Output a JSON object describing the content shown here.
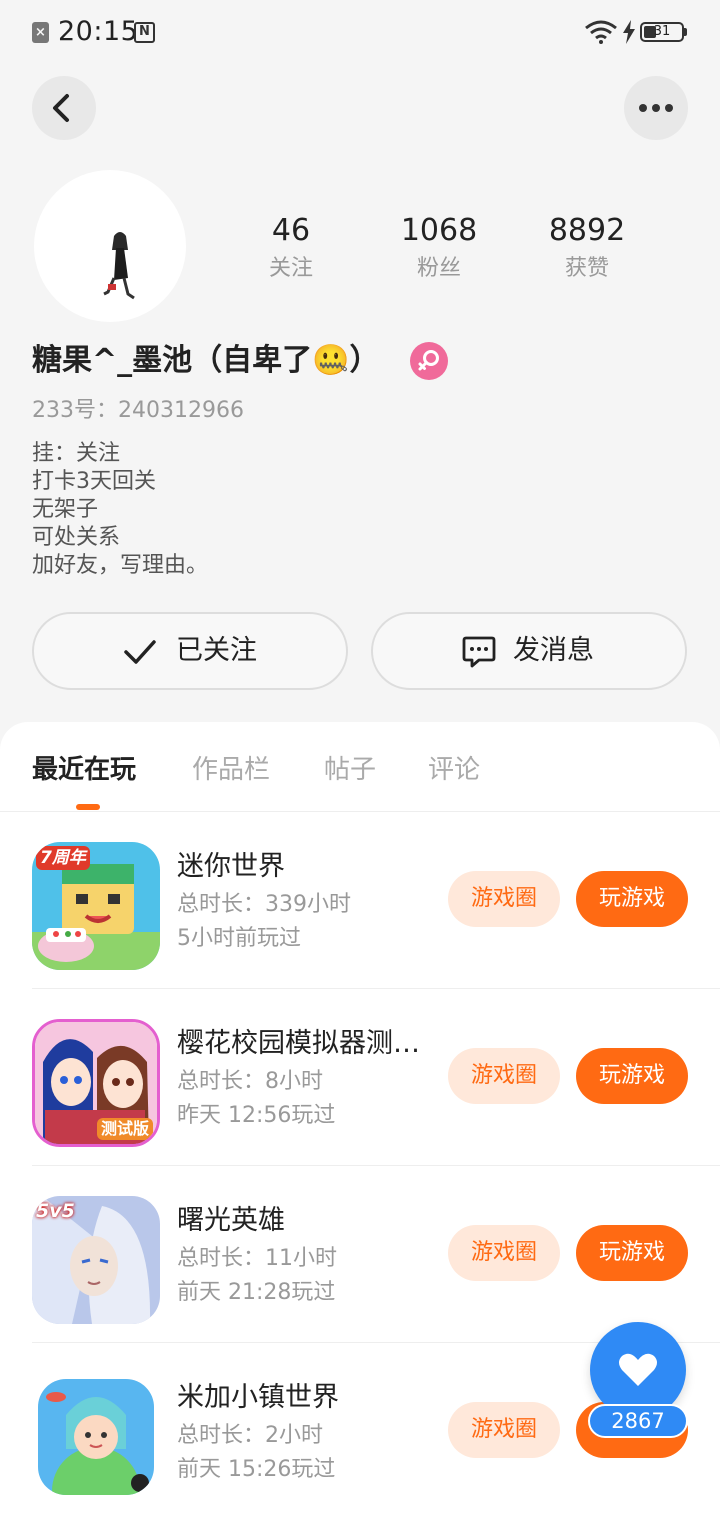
{
  "status_bar": {
    "time": "20:15",
    "battery_level": "31",
    "icons": [
      "notification-icon",
      "nfc-icon",
      "wifi-icon",
      "charging-icon",
      "battery-icon"
    ]
  },
  "nav": {
    "back_icon": "back-arrow-icon",
    "more_icon": "more-dots-icon"
  },
  "profile": {
    "stats": [
      {
        "value": "46",
        "label": "关注"
      },
      {
        "value": "1068",
        "label": "粉丝"
      },
      {
        "value": "8892",
        "label": "获赞"
      }
    ],
    "username": "糖果^_墨池（自卑了🤐）",
    "gender_icon": "female-icon",
    "uid": "233号：240312966",
    "bio": [
      "挂：关注",
      "打卡3天回关",
      "无架子",
      "可处关系",
      "加好友，写理由。"
    ],
    "follow_button": "已关注",
    "message_button": "发消息"
  },
  "tabs": [
    {
      "label": "最近在玩",
      "active": true
    },
    {
      "label": "作品栏",
      "active": false
    },
    {
      "label": "帖子",
      "active": false
    },
    {
      "label": "评论",
      "active": false
    }
  ],
  "games": [
    {
      "name": "迷你世界",
      "duration": "总时长：339小时",
      "last_played": "5小时前玩过",
      "circle_label": "游戏圈",
      "play_label": "玩游戏",
      "icon": "mini-world-game-icon",
      "icon_badge": "7周年"
    },
    {
      "name": "樱花校园模拟器测…",
      "duration": "总时长：8小时",
      "last_played": "昨天 12:56玩过",
      "circle_label": "游戏圈",
      "play_label": "玩游戏",
      "icon": "sakura-school-game-icon",
      "icon_badge": "测试版"
    },
    {
      "name": "曙光英雄",
      "duration": "总时长：11小时",
      "last_played": "前天 21:28玩过",
      "circle_label": "游戏圈",
      "play_label": "玩游戏",
      "icon": "dawn-heroes-game-icon",
      "icon_badge": "5v5"
    },
    {
      "name": "米加小镇世界",
      "duration": "总时长：2小时",
      "last_played": "前天 15:26玩过",
      "circle_label": "游戏圈",
      "play_label": "玩游戏",
      "icon": "miga-town-game-icon",
      "icon_badge": ""
    }
  ],
  "like_fab": {
    "count": "2867",
    "icon": "heart-icon"
  },
  "colors": {
    "accent": "#ff6a13",
    "accent_light": "#ffe8da",
    "fab": "#2f8af5",
    "gender": "#f06a9a"
  }
}
